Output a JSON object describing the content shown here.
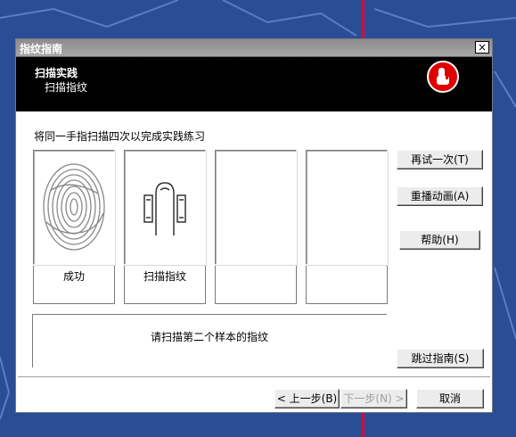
{
  "window": {
    "title": "指纹指南",
    "close_label": "×"
  },
  "header": {
    "title": "扫描实践",
    "subtitle": "扫描指纹"
  },
  "instruction": "将同一手指扫描四次以完成实践练习",
  "samples": [
    {
      "label": "成功",
      "icon": "fingerprint-icon"
    },
    {
      "label": "扫描指纹",
      "icon": "finger-scanner-icon"
    },
    {
      "label": "",
      "icon": ""
    },
    {
      "label": "",
      "icon": ""
    }
  ],
  "status_message": "请扫描第二个样本的指纹",
  "buttons": {
    "retry": "再试一次(T)",
    "replay": "重播动画(A)",
    "help": "帮助(H)",
    "skip": "跳过指南(S)",
    "back": "< 上一步(B)",
    "next": "下一步(N) >",
    "cancel": "取消"
  },
  "colors": {
    "header_bg": "#000000",
    "logo_red": "#e00000",
    "desktop_bg": "#2a4d96"
  }
}
